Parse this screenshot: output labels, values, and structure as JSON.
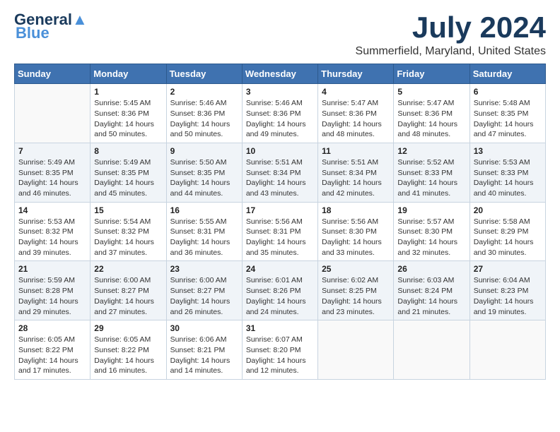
{
  "header": {
    "logo_general": "General",
    "logo_blue": "Blue",
    "month_title": "July 2024",
    "location": "Summerfield, Maryland, United States"
  },
  "days_of_week": [
    "Sunday",
    "Monday",
    "Tuesday",
    "Wednesday",
    "Thursday",
    "Friday",
    "Saturday"
  ],
  "weeks": [
    [
      {
        "day": "",
        "info": ""
      },
      {
        "day": "1",
        "info": "Sunrise: 5:45 AM\nSunset: 8:36 PM\nDaylight: 14 hours\nand 50 minutes."
      },
      {
        "day": "2",
        "info": "Sunrise: 5:46 AM\nSunset: 8:36 PM\nDaylight: 14 hours\nand 50 minutes."
      },
      {
        "day": "3",
        "info": "Sunrise: 5:46 AM\nSunset: 8:36 PM\nDaylight: 14 hours\nand 49 minutes."
      },
      {
        "day": "4",
        "info": "Sunrise: 5:47 AM\nSunset: 8:36 PM\nDaylight: 14 hours\nand 48 minutes."
      },
      {
        "day": "5",
        "info": "Sunrise: 5:47 AM\nSunset: 8:36 PM\nDaylight: 14 hours\nand 48 minutes."
      },
      {
        "day": "6",
        "info": "Sunrise: 5:48 AM\nSunset: 8:35 PM\nDaylight: 14 hours\nand 47 minutes."
      }
    ],
    [
      {
        "day": "7",
        "info": "Sunrise: 5:49 AM\nSunset: 8:35 PM\nDaylight: 14 hours\nand 46 minutes."
      },
      {
        "day": "8",
        "info": "Sunrise: 5:49 AM\nSunset: 8:35 PM\nDaylight: 14 hours\nand 45 minutes."
      },
      {
        "day": "9",
        "info": "Sunrise: 5:50 AM\nSunset: 8:35 PM\nDaylight: 14 hours\nand 44 minutes."
      },
      {
        "day": "10",
        "info": "Sunrise: 5:51 AM\nSunset: 8:34 PM\nDaylight: 14 hours\nand 43 minutes."
      },
      {
        "day": "11",
        "info": "Sunrise: 5:51 AM\nSunset: 8:34 PM\nDaylight: 14 hours\nand 42 minutes."
      },
      {
        "day": "12",
        "info": "Sunrise: 5:52 AM\nSunset: 8:33 PM\nDaylight: 14 hours\nand 41 minutes."
      },
      {
        "day": "13",
        "info": "Sunrise: 5:53 AM\nSunset: 8:33 PM\nDaylight: 14 hours\nand 40 minutes."
      }
    ],
    [
      {
        "day": "14",
        "info": "Sunrise: 5:53 AM\nSunset: 8:32 PM\nDaylight: 14 hours\nand 39 minutes."
      },
      {
        "day": "15",
        "info": "Sunrise: 5:54 AM\nSunset: 8:32 PM\nDaylight: 14 hours\nand 37 minutes."
      },
      {
        "day": "16",
        "info": "Sunrise: 5:55 AM\nSunset: 8:31 PM\nDaylight: 14 hours\nand 36 minutes."
      },
      {
        "day": "17",
        "info": "Sunrise: 5:56 AM\nSunset: 8:31 PM\nDaylight: 14 hours\nand 35 minutes."
      },
      {
        "day": "18",
        "info": "Sunrise: 5:56 AM\nSunset: 8:30 PM\nDaylight: 14 hours\nand 33 minutes."
      },
      {
        "day": "19",
        "info": "Sunrise: 5:57 AM\nSunset: 8:30 PM\nDaylight: 14 hours\nand 32 minutes."
      },
      {
        "day": "20",
        "info": "Sunrise: 5:58 AM\nSunset: 8:29 PM\nDaylight: 14 hours\nand 30 minutes."
      }
    ],
    [
      {
        "day": "21",
        "info": "Sunrise: 5:59 AM\nSunset: 8:28 PM\nDaylight: 14 hours\nand 29 minutes."
      },
      {
        "day": "22",
        "info": "Sunrise: 6:00 AM\nSunset: 8:27 PM\nDaylight: 14 hours\nand 27 minutes."
      },
      {
        "day": "23",
        "info": "Sunrise: 6:00 AM\nSunset: 8:27 PM\nDaylight: 14 hours\nand 26 minutes."
      },
      {
        "day": "24",
        "info": "Sunrise: 6:01 AM\nSunset: 8:26 PM\nDaylight: 14 hours\nand 24 minutes."
      },
      {
        "day": "25",
        "info": "Sunrise: 6:02 AM\nSunset: 8:25 PM\nDaylight: 14 hours\nand 23 minutes."
      },
      {
        "day": "26",
        "info": "Sunrise: 6:03 AM\nSunset: 8:24 PM\nDaylight: 14 hours\nand 21 minutes."
      },
      {
        "day": "27",
        "info": "Sunrise: 6:04 AM\nSunset: 8:23 PM\nDaylight: 14 hours\nand 19 minutes."
      }
    ],
    [
      {
        "day": "28",
        "info": "Sunrise: 6:05 AM\nSunset: 8:22 PM\nDaylight: 14 hours\nand 17 minutes."
      },
      {
        "day": "29",
        "info": "Sunrise: 6:05 AM\nSunset: 8:22 PM\nDaylight: 14 hours\nand 16 minutes."
      },
      {
        "day": "30",
        "info": "Sunrise: 6:06 AM\nSunset: 8:21 PM\nDaylight: 14 hours\nand 14 minutes."
      },
      {
        "day": "31",
        "info": "Sunrise: 6:07 AM\nSunset: 8:20 PM\nDaylight: 14 hours\nand 12 minutes."
      },
      {
        "day": "",
        "info": ""
      },
      {
        "day": "",
        "info": ""
      },
      {
        "day": "",
        "info": ""
      }
    ]
  ]
}
